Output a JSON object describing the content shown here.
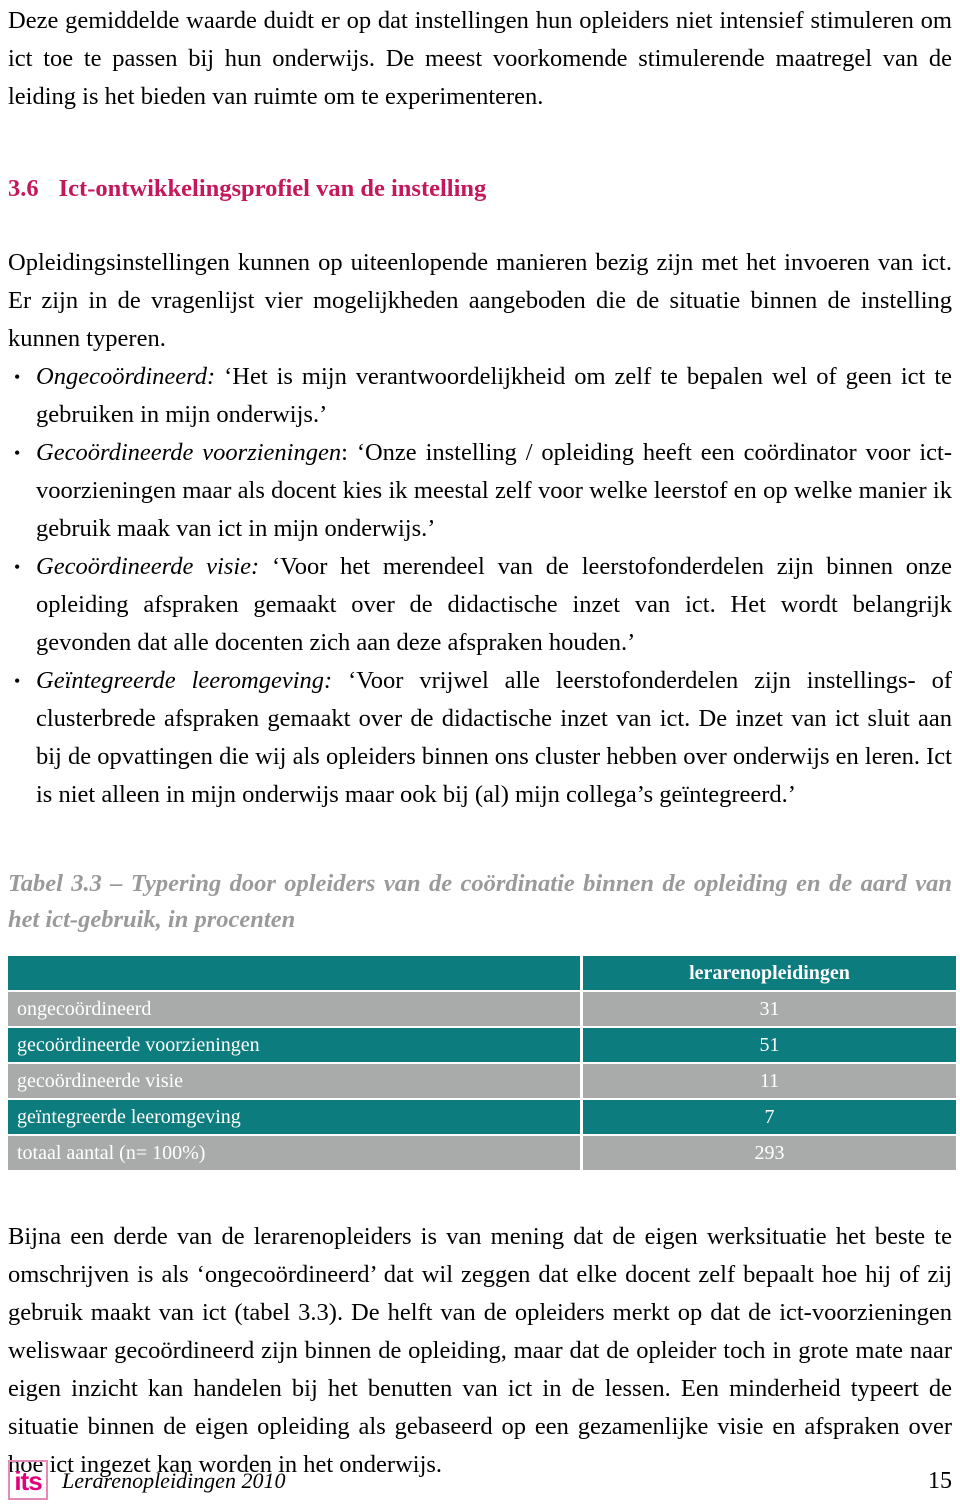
{
  "intro_paragraph": "Deze gemiddelde waarde duidt er op dat instellingen hun opleiders niet intensief stimuleren om ict toe te passen bij hun onderwijs. De meest voorkomende stimulerende maatregel van de leiding is het bieden van ruimte om te experimenteren.",
  "section": {
    "number": "3.6",
    "title": "Ict-ontwikkelingsprofiel van de instelling",
    "color": "#c4175c"
  },
  "section_intro": "Opleidingsinstellingen kunnen op uiteenlopende manieren bezig zijn met het invoeren van ict. Er zijn in de vragenlijst vier mogelijkheden aangeboden die de situatie binnen de instelling kunnen typeren.",
  "bullets": [
    {
      "term": "Ongecoördineerd:",
      "text": " ‘Het is mijn verantwoordelijkheid om zelf te bepalen wel of geen ict te gebruiken in mijn onderwijs.’"
    },
    {
      "term": "Gecoördineerde voorzieningen",
      "text": ": ‘Onze instelling / opleiding heeft een coördinator voor ict-voorzieningen maar als docent kies ik meestal zelf voor welke leerstof en op welke manier ik gebruik maak van ict in mijn onderwijs.’"
    },
    {
      "term": "Gecoördineerde visie:",
      "text": " ‘Voor het merendeel van de leerstofonderdelen zijn binnen onze opleiding afspraken gemaakt over de didactische inzet van ict. Het wordt belangrijk gevonden dat alle docenten zich aan deze afspraken houden.’"
    },
    {
      "term": "Geïntegreerde leeromgeving:",
      "text": " ‘Voor vrijwel alle leerstofonderdelen zijn instellings- of clusterbrede afspraken gemaakt over de didactische inzet van ict. De inzet van ict sluit aan bij de opvattingen die wij als opleiders binnen ons cluster hebben over onderwijs en leren. Ict is niet alleen in mijn onderwijs maar ook bij (al) mijn collega’s geïntegreerd.’"
    }
  ],
  "table": {
    "caption": "Tabel 3.3 – Typering door opleiders van de coördinatie binnen de opleiding en de aard van het ict-gebruik, in procenten",
    "caption_color": "#9a9a9a",
    "header_color": "#0c7c7e",
    "alt_row_color": "#a9abab",
    "columns": [
      "",
      "lerarenopleidingen"
    ],
    "rows": [
      {
        "label": "ongecoördineerd",
        "value": "31"
      },
      {
        "label": "gecoördineerde voorzieningen",
        "value": "51"
      },
      {
        "label": "gecoördineerde visie",
        "value": "11"
      },
      {
        "label": "geïntegreerde leeromgeving",
        "value": "7"
      },
      {
        "label": "totaal aantal (n= 100%)",
        "value": "293"
      }
    ]
  },
  "chart_data": {
    "type": "table",
    "title": "Tabel 3.3 – Typering door opleiders van de coördinatie binnen de opleiding en de aard van het ict-gebruik, in procenten",
    "categories": [
      "ongecoördineerd",
      "gecoördineerde voorzieningen",
      "gecoördineerde visie",
      "geïntegreerde leeromgeving",
      "totaal aantal (n= 100%)"
    ],
    "series": [
      {
        "name": "lerarenopleidingen",
        "values": [
          31,
          51,
          11,
          7,
          293
        ]
      }
    ],
    "xlabel": "",
    "ylabel": "procenten"
  },
  "closing_paragraph": "Bijna een derde van de lerarenopleiders is van mening dat de eigen werksituatie het beste te omschrijven is als ‘ongecoördineerd’ dat wil zeggen dat elke docent zelf bepaalt hoe hij of zij gebruik maakt van ict (tabel 3.3). De helft van de opleiders merkt op dat de ict-voorzieningen weliswaar gecoördineerd zijn binnen de opleiding, maar dat de opleider toch in grote mate naar eigen inzicht kan handelen bij het benutten van ict in de lessen. Een minderheid typeert de situatie binnen de eigen opleiding als gebaseerd op een gezamenlijke visie en afspraken over hoe ict ingezet kan worden in het onderwijs.",
  "footer": {
    "logo_text": "its",
    "logo_color": "#e2007a",
    "title": "Lerarenopleidingen 2010",
    "page_number": "15"
  }
}
